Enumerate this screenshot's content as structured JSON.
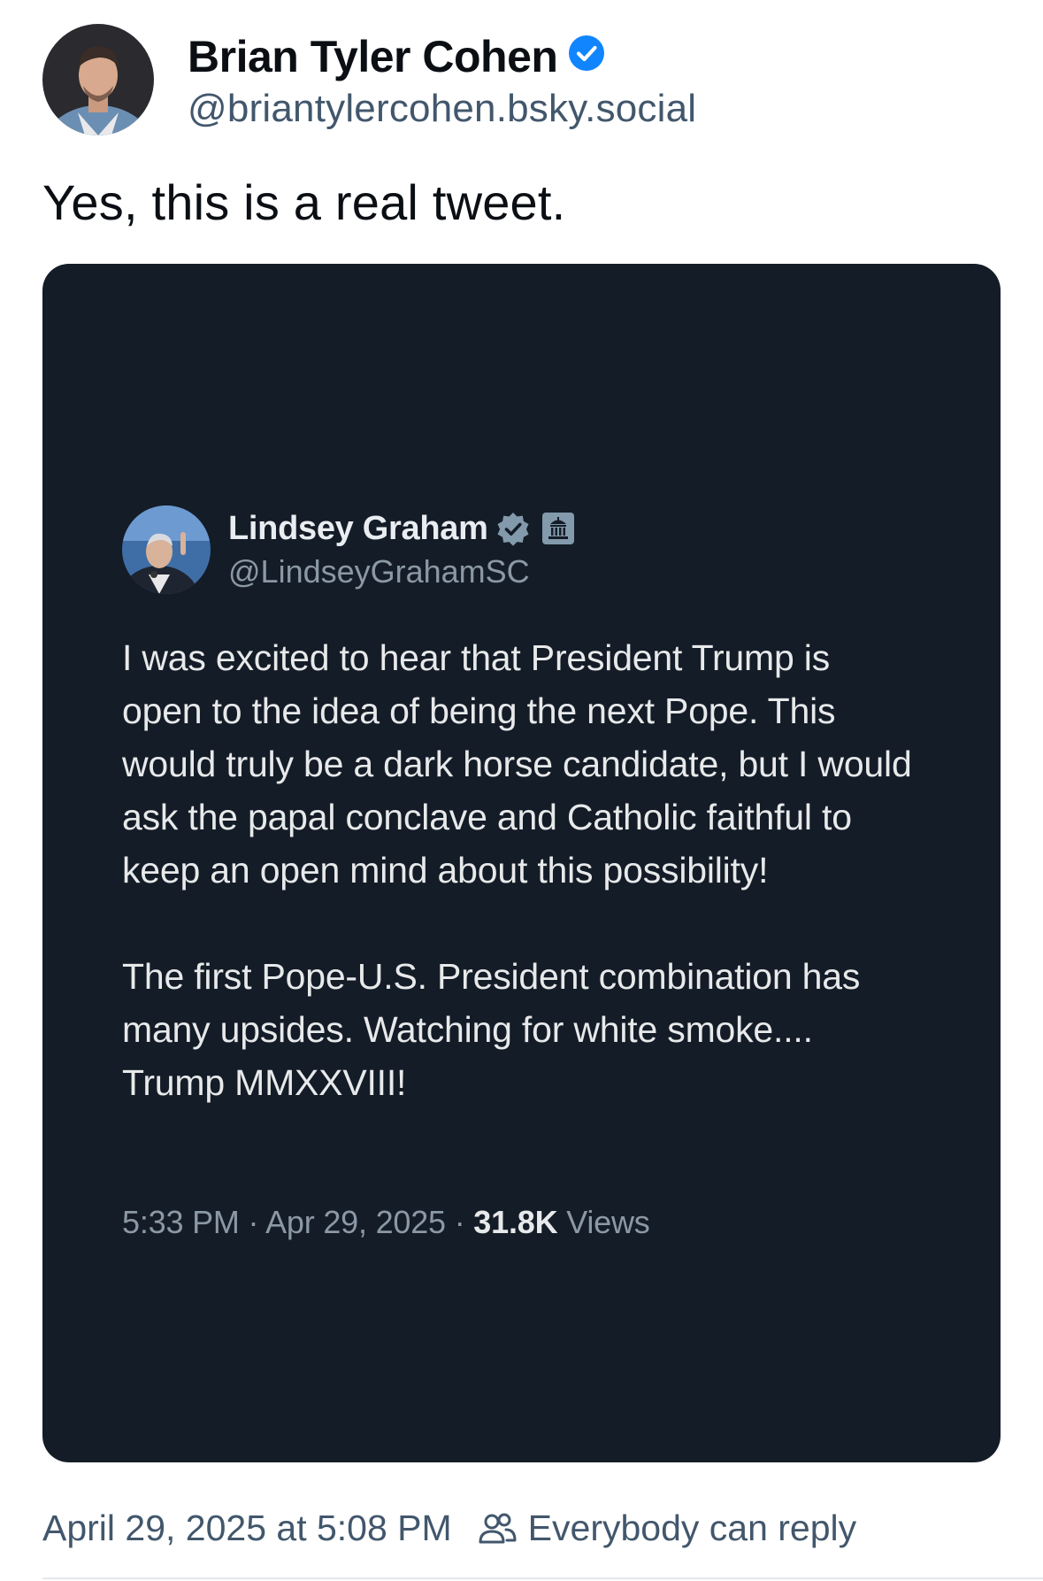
{
  "post": {
    "author": {
      "display_name": "Brian Tyler Cohen",
      "handle": "@briantylercohen.bsky.social",
      "verified_icon": "verified-check-icon"
    },
    "text": "Yes, this is a real tweet.",
    "embedded_image": {
      "author": {
        "display_name": "Lindsey Graham",
        "handle": "@LindseyGrahamSC",
        "verified_icon": "verified-check-icon",
        "affiliation_icon": "government-building-icon"
      },
      "paragraphs": [
        "I was excited to hear that President Trump is open to the idea of being the next Pope. This would truly be a dark horse candidate, but I would ask the papal conclave and Catholic faithful to keep an open mind about this possibility!",
        "The first Pope-U.S. President combination has many upsides. Watching for white smoke.... Trump MMXXVIII!"
      ],
      "time": "5:33 PM",
      "date": "Apr 29, 2025",
      "separator": "·",
      "views_count": "31.8K",
      "views_label": "Views"
    },
    "timestamp": "April 29, 2025 at 5:08 PM",
    "reply_setting": "Everybody can reply",
    "reply_setting_icon": "people-icon"
  },
  "colors": {
    "card_background": "#141c27",
    "verified_blue": "#1185fe",
    "secondary_text": "#42576c"
  }
}
